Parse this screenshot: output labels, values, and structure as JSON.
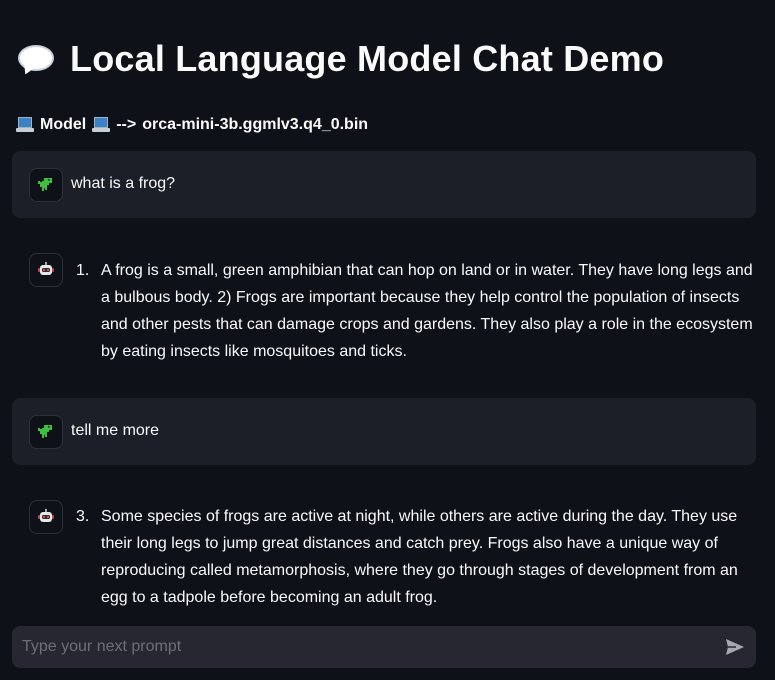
{
  "header": {
    "title": "Local Language Model Chat Demo",
    "title_icon": "speech-balloon-icon"
  },
  "model_info": {
    "label": "Model",
    "arrow": "-->",
    "model_name": "orca-mini-3b.ggmlv3.q4_0.bin",
    "icon": "laptop-icon"
  },
  "messages": [
    {
      "role": "user",
      "avatar_icon": "dinosaur-icon",
      "text": "what is a frog?"
    },
    {
      "role": "assistant",
      "avatar_icon": "robot-icon",
      "number": "1.",
      "text": "A frog is a small, green amphibian that can hop on land or in water. They have long legs and a bulbous body. 2) Frogs are important because they help control the population of insects and other pests that can damage crops and gardens. They also play a role in the ecosystem by eating insects like mosquitoes and ticks."
    },
    {
      "role": "user",
      "avatar_icon": "dinosaur-icon",
      "text": "tell me more"
    },
    {
      "role": "assistant",
      "avatar_icon": "robot-icon",
      "number": "3.",
      "text": "Some species of frogs are active at night, while others are active during the day. They use their long legs to jump great distances and catch prey. Frogs also have a unique way of reproducing called metamorphosis, where they go through stages of development from an egg to a tadpole before becoming an adult frog."
    }
  ],
  "chat_input": {
    "value": "",
    "placeholder": "Type your next prompt",
    "send_icon": "send-icon"
  },
  "colors": {
    "background": "#0e1117",
    "user_message_bg": "#1b1f28",
    "input_bg": "#262730",
    "text": "#fafafa",
    "placeholder": "#6c6f79",
    "dino_green": "#3fbf3f"
  }
}
